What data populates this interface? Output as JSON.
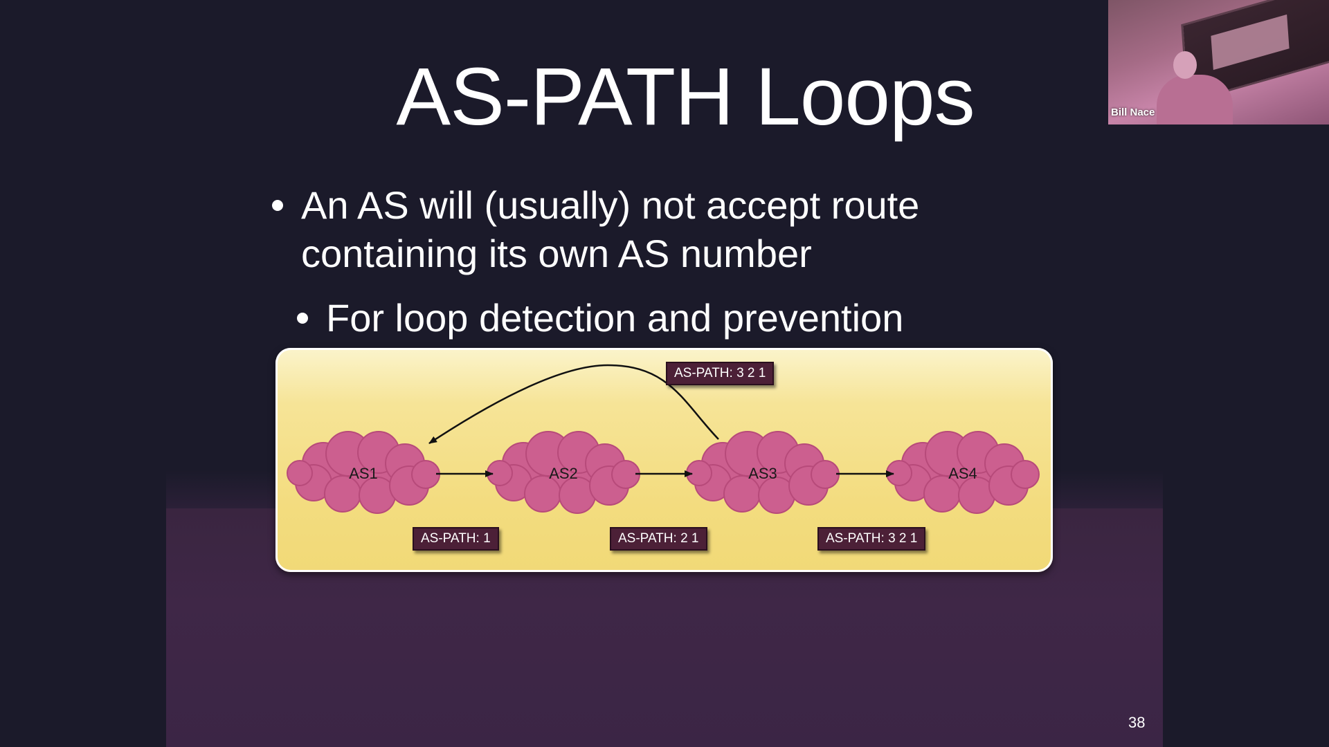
{
  "slide": {
    "title": "AS-PATH Loops",
    "bullets": [
      "An AS will (usually) not accept route containing its own AS number",
      "For loop detection and prevention"
    ],
    "number": "38"
  },
  "diagram": {
    "nodes": [
      "AS1",
      "AS2",
      "AS3",
      "AS4"
    ],
    "path_tags": [
      "AS-PATH: 1",
      "AS-PATH: 2 1",
      "AS-PATH: 3 2 1",
      "AS-PATH: 3 2 1"
    ],
    "colors": {
      "cloud": "#cc5f8f",
      "cloud_stroke": "#b74a7a",
      "panel": "#f3dc7f",
      "tag_bg": "#4c2037",
      "arrow": "#111111"
    }
  },
  "webcam": {
    "name": "Bill Nace"
  }
}
